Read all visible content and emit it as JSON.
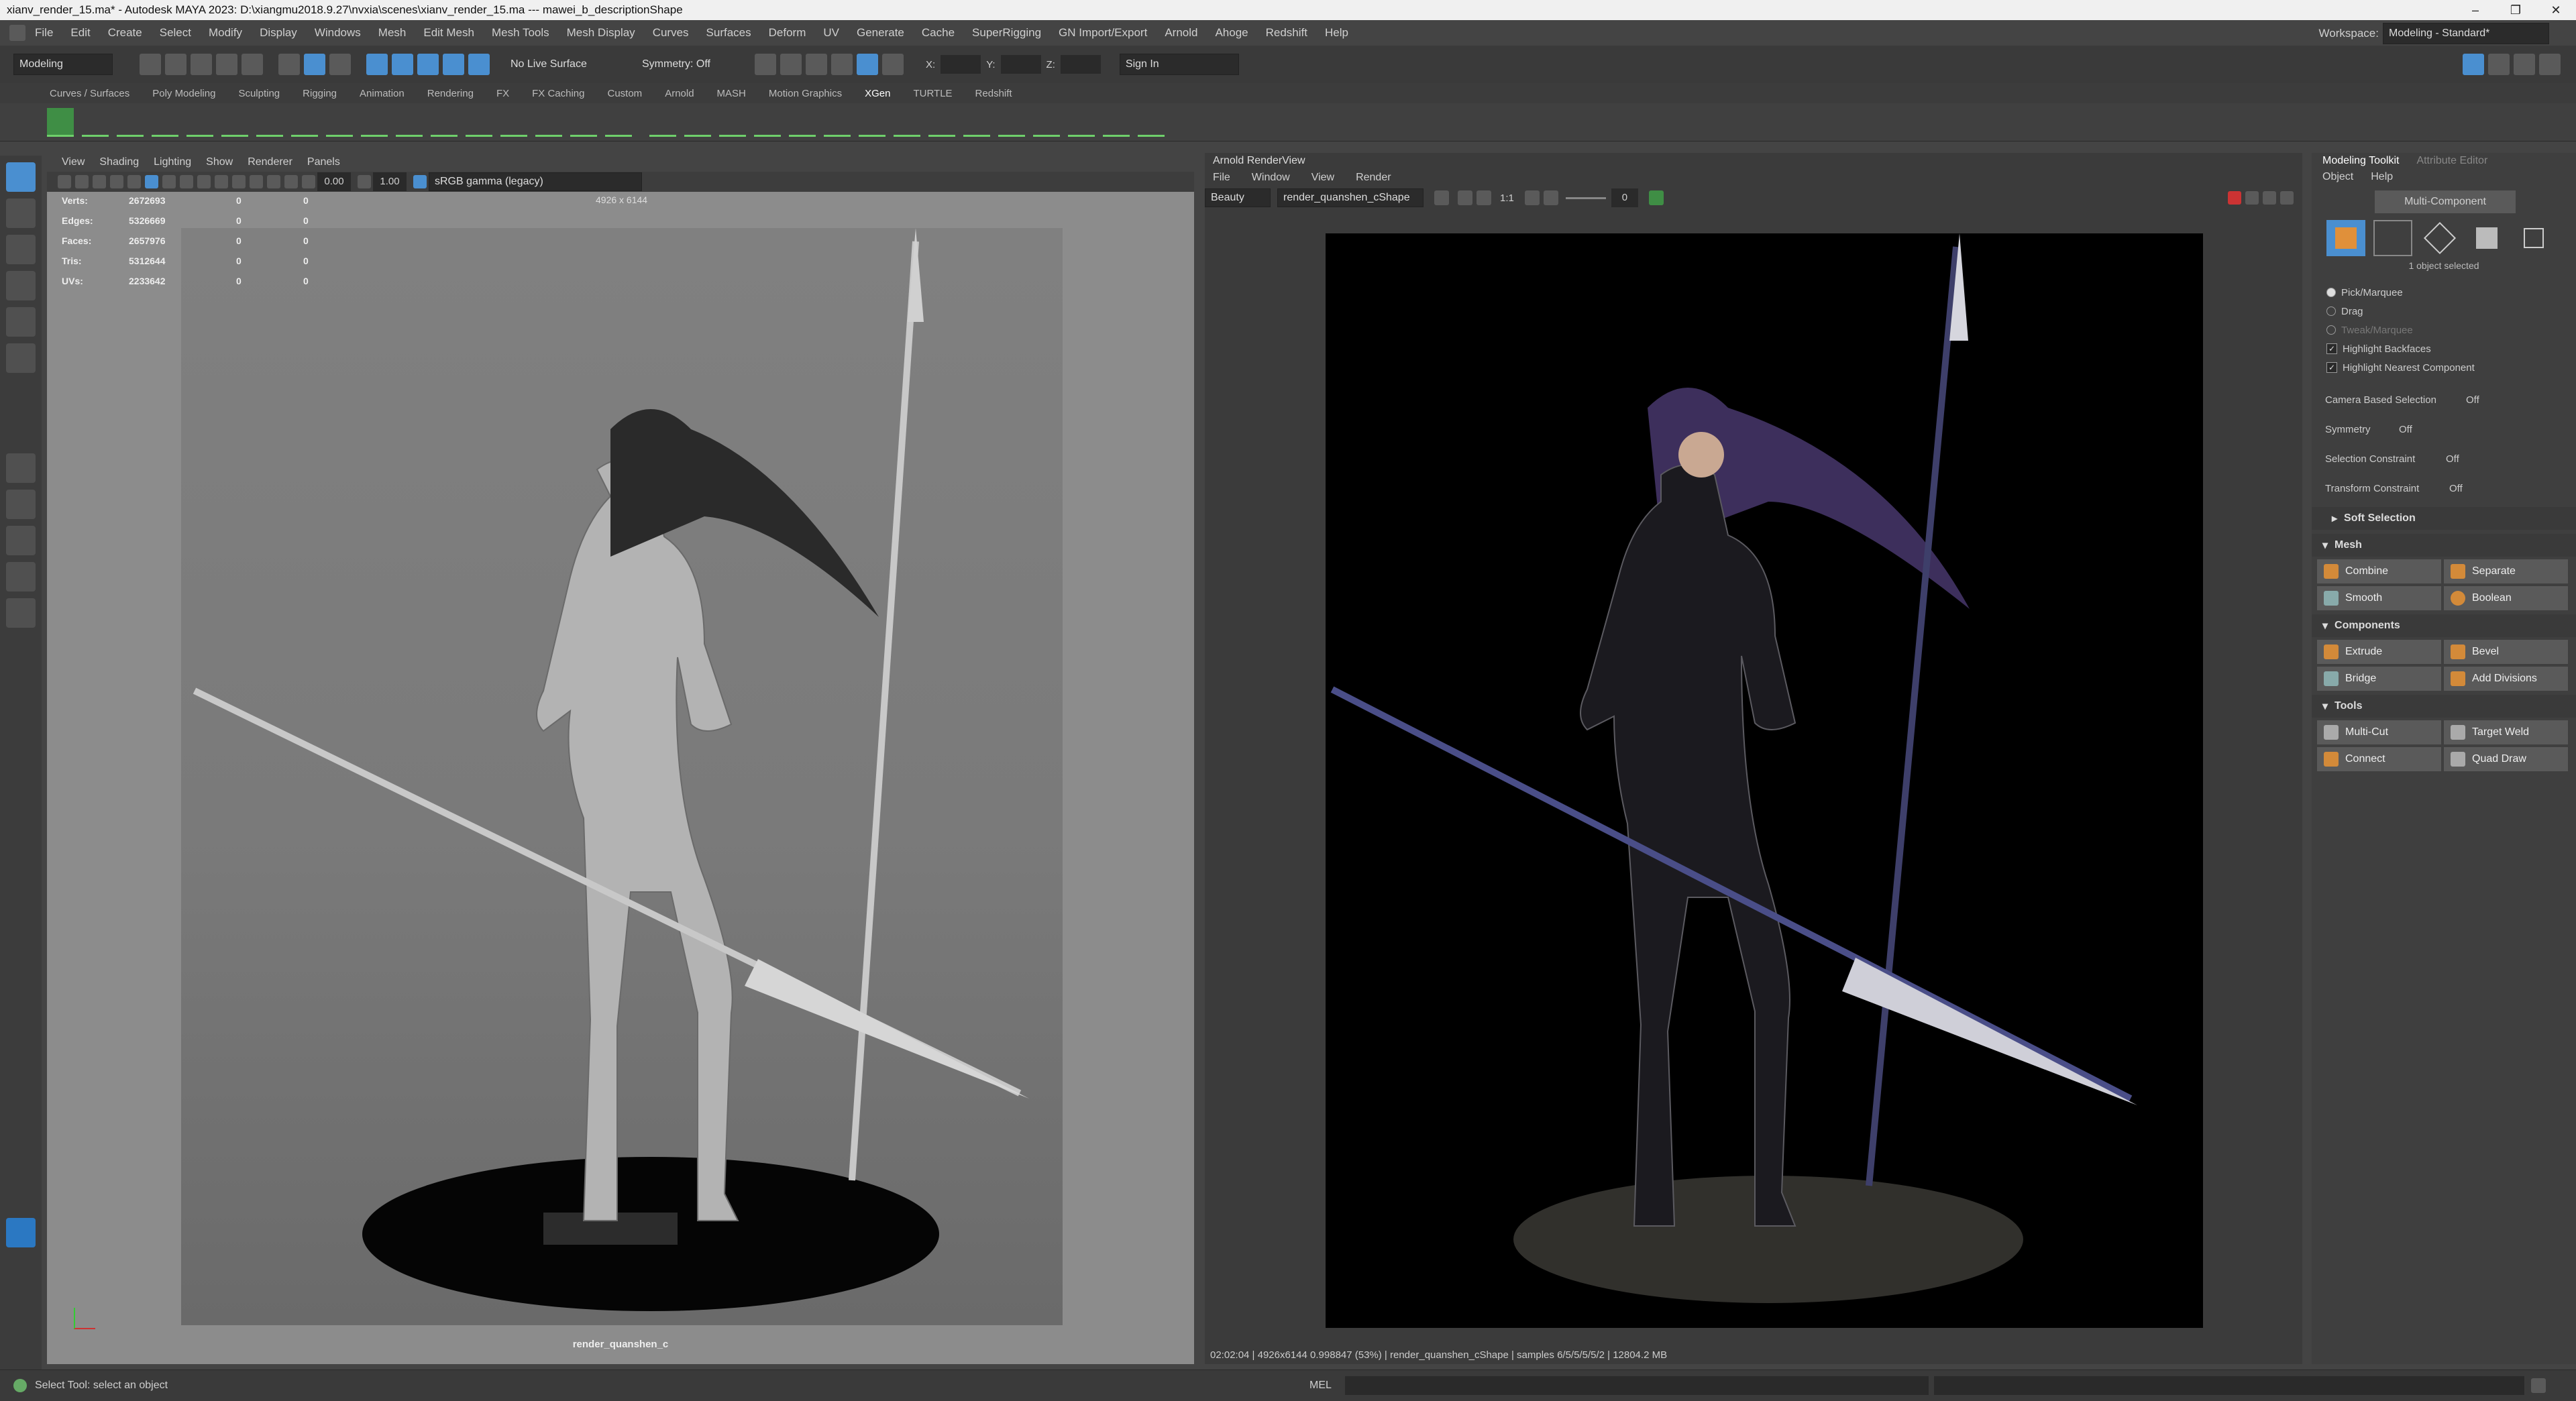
{
  "titlebar": {
    "title": "xianv_render_15.ma* - Autodesk MAYA 2023: D:\\xiangmu2018.9.27\\nvxia\\scenes\\xianv_render_15.ma   ---   mawei_b_descriptionShape",
    "minimize": "–",
    "restore": "❐",
    "close": "✕"
  },
  "menubar": {
    "items": [
      "File",
      "Edit",
      "Create",
      "Select",
      "Modify",
      "Display",
      "Windows",
      "Mesh",
      "Edit Mesh",
      "Mesh Tools",
      "Mesh Display",
      "Curves",
      "Surfaces",
      "Deform",
      "UV",
      "Generate",
      "Cache",
      "SuperRigging",
      "GN Import/Export",
      "Arnold",
      "Ahoge",
      "Redshift",
      "Help"
    ],
    "workspace_label": "Workspace:",
    "workspace_value": "Modeling - Standard*"
  },
  "statusline": {
    "mode": "Modeling",
    "live_surface": "No Live Surface",
    "symmetry": "Symmetry: Off",
    "x_label": "X:",
    "y_label": "Y:",
    "z_label": "Z:",
    "sign_in": "Sign In"
  },
  "shelf": {
    "tabs": [
      "Curves / Surfaces",
      "Poly Modeling",
      "Sculpting",
      "Rigging",
      "Animation",
      "Rendering",
      "FX",
      "FX Caching",
      "Custom",
      "Arnold",
      "MASH",
      "Motion Graphics",
      "XGen",
      "TURTLE",
      "Redshift"
    ],
    "active_tab": "XGen"
  },
  "viewport": {
    "menus": [
      "View",
      "Shading",
      "Lighting",
      "Show",
      "Renderer",
      "Panels"
    ],
    "exposure": "0.00",
    "gamma": "1.00",
    "color_space": "sRGB gamma (legacy)",
    "resolution": "4926 x 6144",
    "hud": [
      {
        "label": "Verts:",
        "v1": "2672693",
        "v2": "0",
        "v3": "0"
      },
      {
        "label": "Edges:",
        "v1": "5326669",
        "v2": "0",
        "v3": "0"
      },
      {
        "label": "Faces:",
        "v1": "2657976",
        "v2": "0",
        "v3": "0"
      },
      {
        "label": "Tris:",
        "v1": "5312644",
        "v2": "0",
        "v3": "0"
      },
      {
        "label": "UVs:",
        "v1": "2233642",
        "v2": "0",
        "v3": "0"
      }
    ],
    "camera": "render_quanshen_c"
  },
  "renderview": {
    "title": "Arnold RenderView",
    "menus": [
      "File",
      "Window",
      "View",
      "Render"
    ],
    "aov": "Beauty",
    "camera": "render_quanshen_cShape",
    "ratio": "1:1",
    "value": "0",
    "status": "02:02:04 | 4926x6144 0.998847 (53%) | render_quanshen_cShape | samples 6/5/5/5/5/2 | 12804.2 MB"
  },
  "modeling_toolkit": {
    "tabs": [
      "Modeling Toolkit",
      "Attribute Editor"
    ],
    "submenus": [
      "Object",
      "Help"
    ],
    "multi_component": "Multi-Component",
    "selected": "1 object selected",
    "pick_options": [
      "Pick/Marquee",
      "Drag",
      "Tweak/Marquee"
    ],
    "checkboxes": [
      "Highlight Backfaces",
      "Highlight Nearest Component"
    ],
    "settings": [
      {
        "label": "Camera Based Selection",
        "value": "Off"
      },
      {
        "label": "Symmetry",
        "value": "Off"
      },
      {
        "label": "Selection Constraint",
        "value": "Off"
      },
      {
        "label": "Transform Constraint",
        "value": "Off"
      }
    ],
    "soft_selection": "Soft Selection",
    "mesh_section": "Mesh",
    "mesh_buttons": [
      "Combine",
      "Separate",
      "Smooth",
      "Boolean"
    ],
    "components_section": "Components",
    "component_buttons": [
      "Extrude",
      "Bevel",
      "Bridge",
      "Add Divisions"
    ],
    "tools_section": "Tools",
    "tool_buttons": [
      "Multi-Cut",
      "Target Weld",
      "Connect",
      "Quad Draw"
    ]
  },
  "helpline": {
    "text": "Select Tool: select an object",
    "script_lang": "MEL"
  }
}
